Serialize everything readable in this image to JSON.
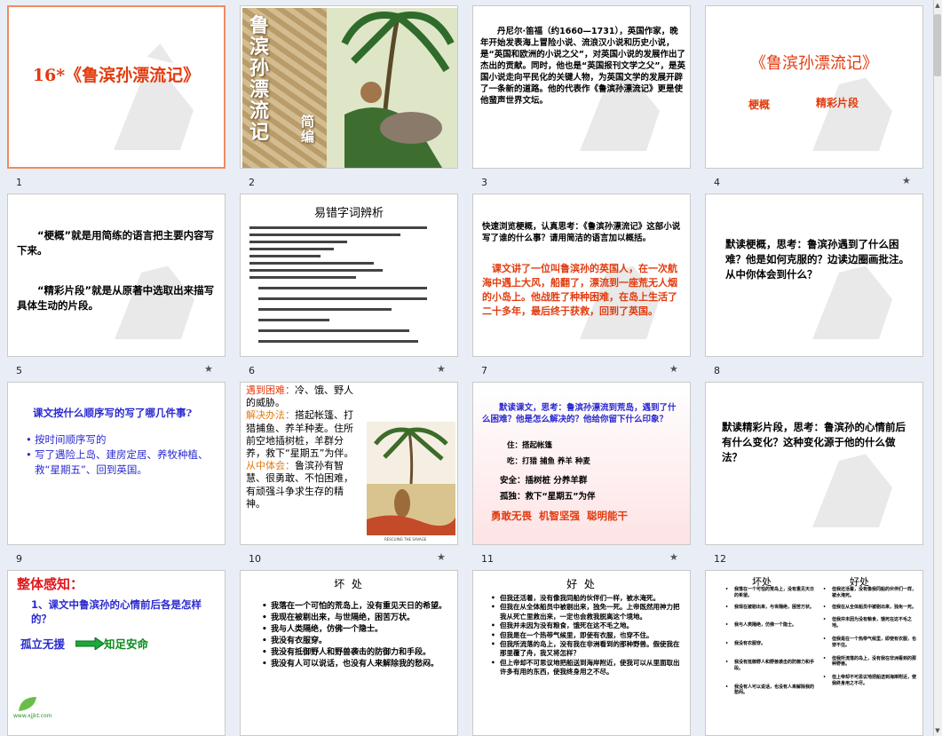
{
  "slides": [
    {
      "num": "1",
      "star": "",
      "title": "16*《鲁滨孙漂流记》"
    },
    {
      "num": "2",
      "star": "",
      "cover_title": "鲁滨孙漂流记",
      "cover_sub": "简编"
    },
    {
      "num": "3",
      "star": "",
      "text": "丹尼尔·笛福（约1660—1731），英国作家，晚年开始发表海上冒险小说、流浪汉小说和历史小说，是“英国和欧洲的小说之父”，对英国小说的发展作出了杰出的贡献。同时，他也是“英国报刊文学之父”，是英国小说走向平民化的关键人物，为英国文学的发展开辟了一条新的道路。他的代表作《鲁滨孙漂流记》更是使他蜚声世界文坛。"
    },
    {
      "num": "4",
      "star": "★",
      "title": "《鲁滨孙漂流记》",
      "label1": "梗概",
      "label2": "精彩片段"
    },
    {
      "num": "5",
      "star": "★",
      "p1": "“梗概”就是用简练的语言把主要内容写下来。",
      "p2": "“精彩片段”就是从原著中选取出来描写具体生动的片段。"
    },
    {
      "num": "6",
      "star": "★",
      "title": "易错字词辨析"
    },
    {
      "num": "7",
      "star": "★",
      "q": "快速浏览梗概，认真思考：《鲁滨孙漂流记》这部小说写了谁的什么事？请用简洁的语言加以概括。",
      "a": "课文讲了一位叫鲁滨孙的英国人，在一次航海中遇上大风，船翻了，漂流到一座荒无人烟的小岛上。他战胜了种种困难，在岛上生活了二十多年，最后终于获救，回到了英国。"
    },
    {
      "num": "8",
      "star": "",
      "text": "默读梗概，思考：鲁滨孙遇到了什么困难？他是如何克服的？边读边圈画批注。从中你体会到什么？"
    },
    {
      "num": "9",
      "star": "",
      "q": "课文按什么顺序写的写了哪几件事?",
      "items": [
        "按时间顺序写的",
        "写了遇险上岛、建房定居、养牧种植、救“星期五”、回到英国。"
      ]
    },
    {
      "num": "10",
      "star": "★",
      "k1": "遇到困难：",
      "v1": "冷、饿、野人的威胁。",
      "k2": "解决办法：",
      "v2": "搭起帐篷、打猎捕鱼、养羊种麦。住所前空地插树桩，羊群分养，救下“星期五”为伴。",
      "k3": "从中体会：",
      "v3": "鲁滨孙有智慧、很勇敢、不怕困难，有顽强斗争求生存的精神。",
      "caption": "RESCUING THE SAVAGE"
    },
    {
      "num": "11",
      "star": "★",
      "q": "默读课文，思考：鲁滨孙漂流到荒岛，遇到了什么困难？他是怎么解决的？他给你留下什么印象？",
      "rows": [
        {
          "k": "住：",
          "v": "搭起帐篷"
        },
        {
          "k": "吃：",
          "v": "打猎 捕鱼 养羊 种麦"
        },
        {
          "k": "安全：",
          "v": "插树桩 分养羊群"
        },
        {
          "k": "孤独：",
          "v": "救下“星期五”为伴"
        }
      ],
      "traits": "勇敢无畏 机智坚强 聪明能干"
    },
    {
      "num": "12",
      "star": "",
      "text": "默读精彩片段，思考：鲁滨孙的心情前后有什么变化？这种变化源于他的什么做法？"
    },
    {
      "num": "",
      "star": "",
      "h": "整体感知：",
      "q": "1、课文中鲁滨孙的心情前后各是怎样的？",
      "from": "孤立无援",
      "to": "知足安命",
      "logo": "www.xjjkt.com"
    },
    {
      "num": "",
      "star": "",
      "title": "坏 处",
      "items": [
        "我落在一个可怕的荒岛上，没有重见天日的希望。",
        "我现在被剔出来，与世隔绝，困苦万状。",
        "我与人类隔绝，仿佛一个隐士。",
        "我没有衣服穿。",
        "我没有抵御野人和野兽袭击的防御力和手段。",
        "我没有人可以说话，也没有人来解除我的愁闷。"
      ]
    },
    {
      "num": "",
      "star": "",
      "title": "好 处",
      "items": [
        "但我还活着，没有像我同船的伙伴们一样，被水淹死。",
        "但我在从全体船员中被剔出来，独免一死。上帝既然用神力把我从死亡里救出来，一定也会救我脱离这个境地。",
        "但我并未因为没有粮食，饿死在这不毛之地。",
        "但我是在一个热带气候里，即使有衣服，也穿不住。",
        "但我所流落的岛上，没有我在非洲看到的那种野兽。假使我在那里覆了舟，我又将怎样？",
        "但上帝却不可思议地把船送到海岸附近，使我可以从里面取出许多有用的东西，使我终身用之不尽。"
      ]
    },
    {
      "num": "",
      "star": "",
      "title_a": "坏处",
      "title_b": "好处",
      "left": [
        "我落在一个可怕的荒岛上，没有重见天日的希望。",
        "我现在被剔出来，与世隔绝，困苦万状。",
        "我与人类隔绝，仿佛一个隐士。",
        "我没有衣服穿。",
        "我没有抵御野人和野兽袭击的防御力和手段。",
        "我没有人可以说话，也没有人来解除我的愁闷。"
      ],
      "right": [
        "但我还活着，没有像我同船的伙伴们一样，被水淹死。",
        "但我在从全体船员中被剔出来，独免一死。",
        "但我并未因为没有粮食，饿死在这不毛之地。",
        "但我是在一个热带气候里，即使有衣服，也穿不住。",
        "但我所流落的岛上，没有我在非洲看到的那种野兽。",
        "但上帝却不可思议地把船送到海岸附近，使我终身用之不尽。"
      ]
    }
  ]
}
